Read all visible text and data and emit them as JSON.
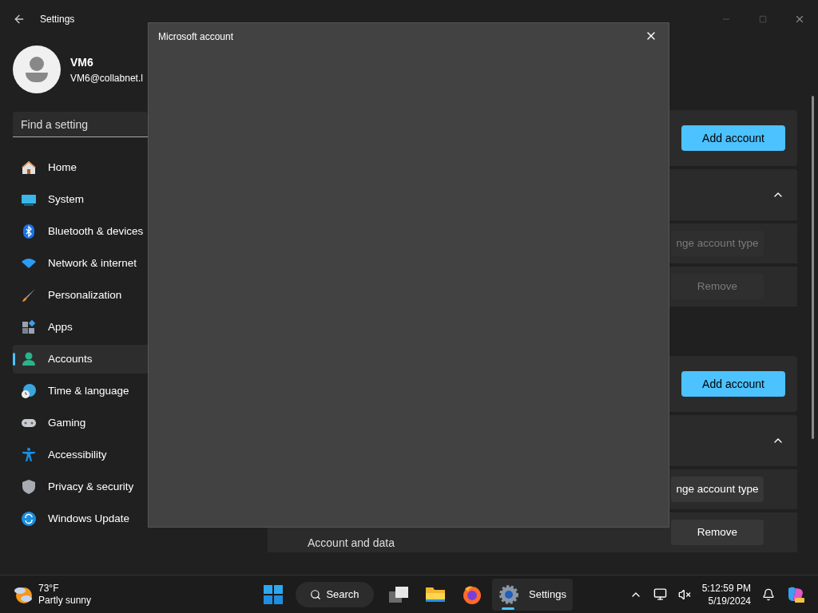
{
  "window": {
    "title": "Settings"
  },
  "user": {
    "name": "VM6",
    "email": "VM6@collabnet.l"
  },
  "search": {
    "placeholder": "Find a setting"
  },
  "nav": [
    {
      "label": "Home",
      "kind": "home",
      "selected": false
    },
    {
      "label": "System",
      "kind": "system",
      "selected": false
    },
    {
      "label": "Bluetooth & devices",
      "kind": "bluetooth",
      "selected": false
    },
    {
      "label": "Network & internet",
      "kind": "network",
      "selected": false
    },
    {
      "label": "Personalization",
      "kind": "brush",
      "selected": false
    },
    {
      "label": "Apps",
      "kind": "apps",
      "selected": false
    },
    {
      "label": "Accounts",
      "kind": "accounts",
      "selected": true
    },
    {
      "label": "Time & language",
      "kind": "time",
      "selected": false
    },
    {
      "label": "Gaming",
      "kind": "gaming",
      "selected": false
    },
    {
      "label": "Accessibility",
      "kind": "accessibility",
      "selected": false
    },
    {
      "label": "Privacy & security",
      "kind": "privacy",
      "selected": false
    },
    {
      "label": "Windows Update",
      "kind": "update",
      "selected": false
    }
  ],
  "sections": [
    {
      "add_button": "Add account",
      "account": {
        "expanded": true,
        "rows": [
          {
            "action": "nge account type",
            "disabled": true
          },
          {
            "action": "Remove",
            "disabled": true
          }
        ]
      }
    },
    {
      "add_button": "Add account",
      "account": {
        "expanded": true,
        "rows": [
          {
            "action": "nge account type",
            "disabled": false
          },
          {
            "label": "Account and data",
            "action": "Remove",
            "disabled": false
          }
        ]
      }
    }
  ],
  "dialog": {
    "title": "Microsoft account"
  },
  "taskbar": {
    "temperature": "73°F",
    "condition": "Partly sunny",
    "search": "Search",
    "apps": [
      {
        "kind": "taskview",
        "selected": false
      },
      {
        "kind": "explorer",
        "selected": false
      },
      {
        "kind": "firefox",
        "selected": false
      },
      {
        "kind": "settings",
        "label": "Settings",
        "selected": true
      }
    ],
    "time": "5:12:59 PM",
    "date": "5/19/2024"
  }
}
